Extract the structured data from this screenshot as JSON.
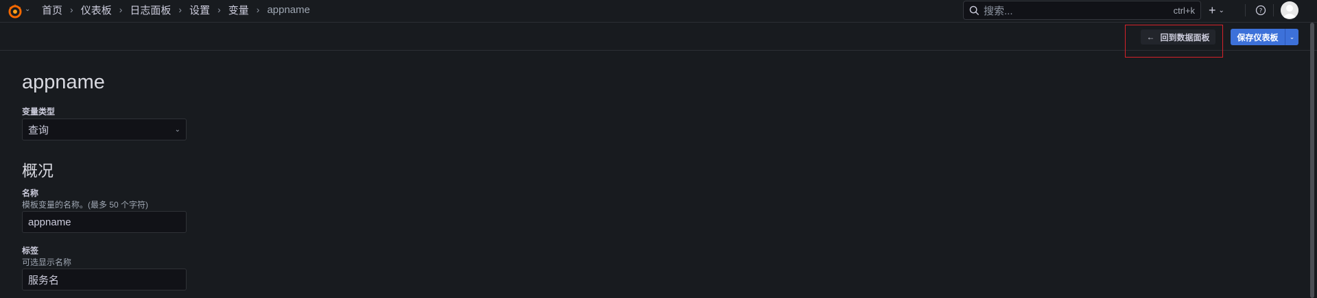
{
  "colors": {
    "background": "#181b1f",
    "primary_button": "#3d71d9",
    "highlight": "#d8222a",
    "logo_orange": "#f46800"
  },
  "topbar": {
    "logo_icon": "grafana-logo-icon",
    "breadcrumb": [
      "首页",
      "仪表板",
      "日志面板",
      "设置",
      "变量",
      "appname"
    ],
    "search": {
      "placeholder": "搜索...",
      "shortcut": "ctrl+k"
    },
    "plus_icon": "plus-icon",
    "help_icon": "help-icon",
    "avatar_icon": "user-avatar"
  },
  "toolbar": {
    "back_label": "回到数据面板",
    "save_label": "保存仪表板"
  },
  "main": {
    "title": "appname",
    "variable_type": {
      "label": "变量类型",
      "value": "查询"
    },
    "section_overview": "概况",
    "name": {
      "label": "名称",
      "description": "模板变量的名称。(最多 50 个字符)",
      "value": "appname"
    },
    "tag": {
      "label": "标签",
      "description": "可选显示名称",
      "value": "服务名"
    }
  }
}
